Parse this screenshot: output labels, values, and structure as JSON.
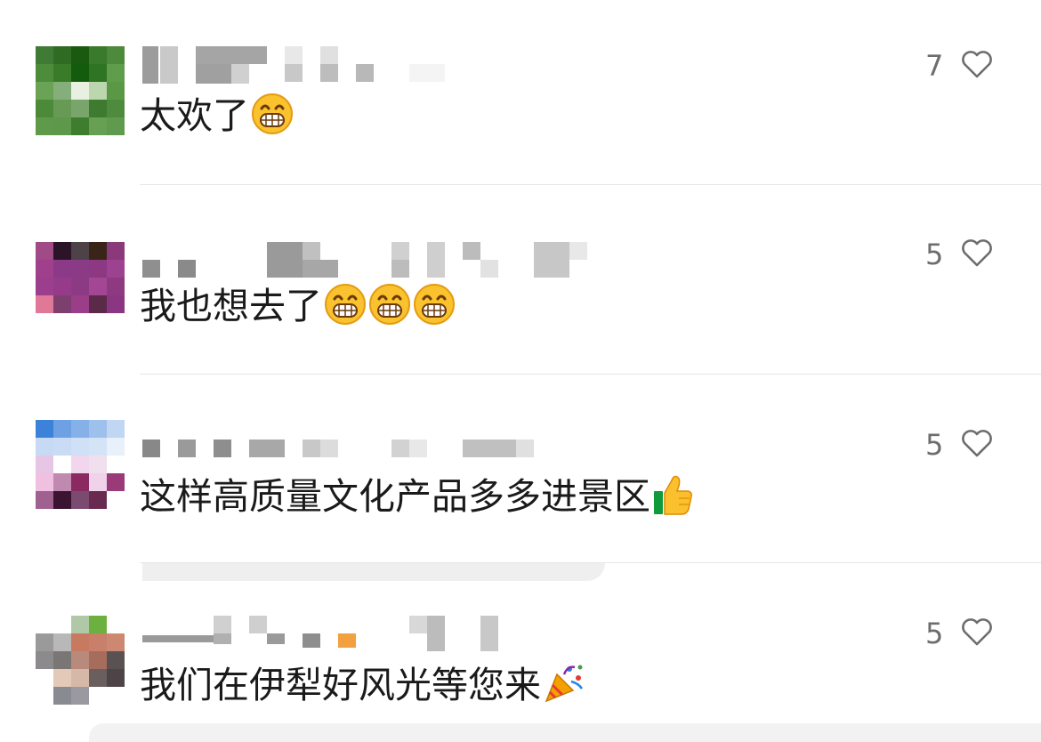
{
  "comments": [
    {
      "text": "太欢了",
      "likes": "7",
      "emoji": [
        "grin"
      ]
    },
    {
      "text": "我也想去了",
      "likes": "5",
      "emoji": [
        "grin",
        "grin",
        "grin"
      ]
    },
    {
      "text": "这样高质量文化产品多多进景区",
      "likes": "5",
      "emoji": [
        "thumbs-up"
      ]
    },
    {
      "text": "我们在伊犁好风光等您来",
      "likes": "5",
      "emoji": [
        "party-popper"
      ]
    }
  ],
  "colors": {
    "text": "#1a1a1a",
    "count": "#6d6d6d",
    "divider": "#e6e6e6"
  }
}
